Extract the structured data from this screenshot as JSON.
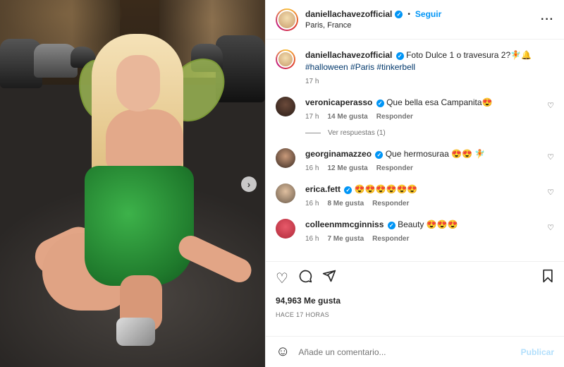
{
  "post": {
    "username": "daniellachavezofficial",
    "follow_label": "Seguir",
    "location": "Paris, France",
    "caption_text": "Foto Dulce 1 o travesura 2?🧚🔔",
    "caption_tags": "#halloween #Paris #tinkerbell",
    "caption_time": "17 h",
    "likes": "94,963 Me gusta",
    "posted_ago": "HACE 17 HORAS",
    "add_comment_placeholder": "Añade un comentario...",
    "publish_label": "Publicar"
  },
  "comments": [
    {
      "username": "veronicaperasso",
      "text": "Que bella esa Campanita😍",
      "time": "17 h",
      "likes": "14 Me gusta",
      "reply": "Responder"
    },
    {
      "username": "georginamazzeo",
      "text": "Que hermosuraa 😍😍 🧚",
      "time": "16 h",
      "likes": "12 Me gusta",
      "reply": "Responder"
    },
    {
      "username": "erica.fett",
      "text": "😍😍😍😍😍😍",
      "time": "16 h",
      "likes": "8 Me gusta",
      "reply": "Responder"
    },
    {
      "username": "colleenmmcginniss",
      "text": "Beauty 😍😍😍",
      "time": "16 h",
      "likes": "7 Me gusta",
      "reply": "Responder"
    }
  ],
  "view_replies": "Ver respuestas (1)",
  "icons": {
    "heart": "heart-icon",
    "comment": "comment-icon",
    "share": "share-icon",
    "save": "bookmark-icon",
    "more": "more-icon",
    "emoji": "emoji-icon",
    "next": "chevron-right-icon"
  },
  "colors": {
    "accent": "#0095f6",
    "link": "#00376b",
    "muted": "#737373"
  }
}
